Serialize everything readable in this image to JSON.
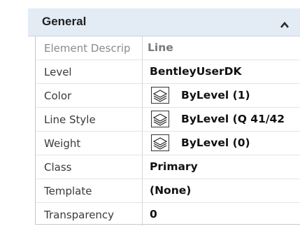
{
  "section": {
    "title": "General",
    "collapse_icon": "chevron-up-icon"
  },
  "properties": [
    {
      "label": "Element Descrip",
      "value": "Line",
      "has_swatch": false
    },
    {
      "label": "Level",
      "value": "BentleyUserDK",
      "has_swatch": false
    },
    {
      "label": "Color",
      "value": "ByLevel (1)",
      "has_swatch": true
    },
    {
      "label": "Line Style",
      "value": "ByLevel (Q 41/42",
      "has_swatch": true
    },
    {
      "label": "Weight",
      "value": "ByLevel (0)",
      "has_swatch": true
    },
    {
      "label": "Class",
      "value": "Primary",
      "has_swatch": false
    },
    {
      "label": "Template",
      "value": "(None)",
      "has_swatch": false
    },
    {
      "label": "Transparency",
      "value": "0",
      "has_swatch": false
    }
  ],
  "colors": {
    "header_bg": "#e3ebf5",
    "grid_line": "#d6d6d6"
  }
}
